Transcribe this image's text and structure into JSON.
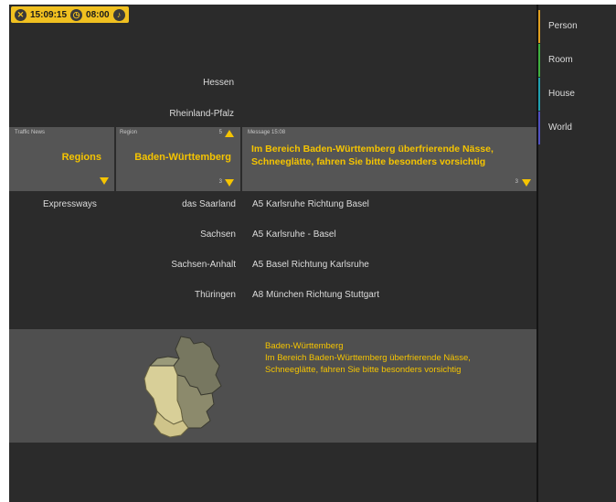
{
  "status": {
    "time": "15:09:15",
    "alarm": "08:00",
    "icons": [
      "close-icon",
      "clock-icon",
      "bell-icon"
    ]
  },
  "regions_above": [
    "Hessen",
    "Rheinland-Pfalz"
  ],
  "panels": {
    "category": {
      "small_label": "Traffic News",
      "value": "Regions"
    },
    "region": {
      "small_label": "Region",
      "count_top": "5",
      "value": "Baden-Württemberg",
      "count_bottom": "3"
    },
    "message": {
      "small_label": "Message 15:08",
      "text": "Im Bereich Baden-Württemberg überfrierende Nässe, Schneeglätte, fahren Sie bitte besonders vorsichtig",
      "count": "3"
    }
  },
  "category_list": [
    "Expressways"
  ],
  "regions_below": [
    "das Saarland",
    "Sachsen",
    "Sachsen-Anhalt",
    "Thüringen"
  ],
  "messages": [
    "A5 Karlsruhe Richtung Basel",
    "A5 Karlsruhe - Basel",
    "A5 Basel Richtung Karlsruhe",
    "A8 München Richtung Stuttgart"
  ],
  "detail": {
    "title": "Baden-Württemberg",
    "body": "Im Bereich Baden-Württemberg überfrierende Nässe, Schneeglätte, fahren Sie bitte besonders vorsichtig"
  },
  "sidebar": [
    {
      "label": "Person",
      "color": "#e0a020"
    },
    {
      "label": "Room",
      "color": "#40b040"
    },
    {
      "label": "House",
      "color": "#20a0b0"
    },
    {
      "label": "World",
      "color": "#5050c0"
    }
  ]
}
